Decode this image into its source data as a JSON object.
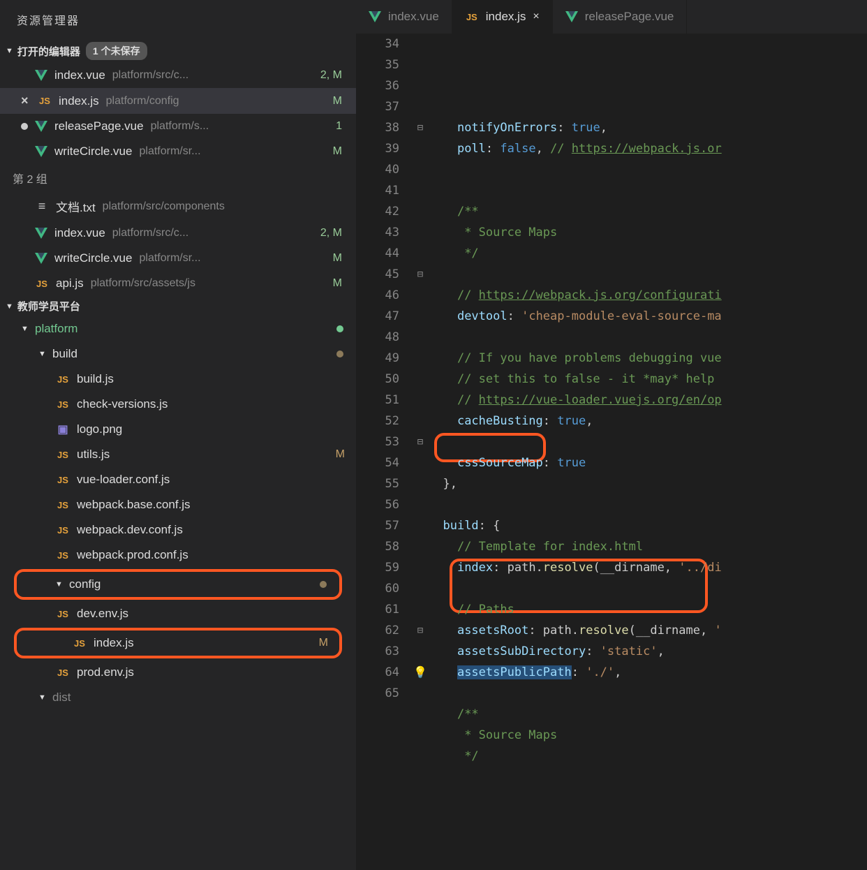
{
  "sidebar": {
    "title": "资源管理器",
    "openEditors": {
      "label": "打开的编辑器",
      "unsavedBadge": "1 个未保存",
      "groups": [
        {
          "items": [
            {
              "dot": false,
              "close": false,
              "icon": "vue",
              "name": "index.vue",
              "path": "platform/src/c...",
              "status": "2, M"
            },
            {
              "dot": false,
              "close": true,
              "icon": "js",
              "name": "index.js",
              "path": "platform/config",
              "status": "M",
              "active": true
            },
            {
              "dot": true,
              "close": false,
              "icon": "vue",
              "name": "releasePage.vue",
              "path": "platform/s...",
              "status": "1"
            },
            {
              "dot": false,
              "close": false,
              "icon": "vue",
              "name": "writeCircle.vue",
              "path": "platform/sr...",
              "status": "M"
            }
          ]
        },
        {
          "label": "第 2 组",
          "items": [
            {
              "dot": false,
              "close": false,
              "icon": "txt",
              "name": "文档.txt",
              "path": "platform/src/components",
              "status": ""
            },
            {
              "dot": false,
              "close": false,
              "icon": "vue",
              "name": "index.vue",
              "path": "platform/src/c...",
              "status": "2, M"
            },
            {
              "dot": false,
              "close": false,
              "icon": "vue",
              "name": "writeCircle.vue",
              "path": "platform/sr...",
              "status": "M"
            },
            {
              "dot": false,
              "close": false,
              "icon": "js",
              "name": "api.js",
              "path": "platform/src/assets/js",
              "status": "M"
            }
          ]
        }
      ]
    },
    "workspace": {
      "label": "教师学员平台",
      "tree": [
        {
          "level": 0,
          "type": "folder",
          "open": true,
          "name": "platform",
          "nameClass": "green",
          "dot": "green"
        },
        {
          "level": 1,
          "type": "folder",
          "open": true,
          "name": "build",
          "dot": "brown"
        },
        {
          "level": 2,
          "type": "file",
          "icon": "js",
          "name": "build.js",
          "status": ""
        },
        {
          "level": 2,
          "type": "file",
          "icon": "js",
          "name": "check-versions.js",
          "status": ""
        },
        {
          "level": 2,
          "type": "file",
          "icon": "img",
          "name": "logo.png",
          "status": ""
        },
        {
          "level": 2,
          "type": "file",
          "icon": "js",
          "name": "utils.js",
          "status": "M"
        },
        {
          "level": 2,
          "type": "file",
          "icon": "js",
          "name": "vue-loader.conf.js",
          "status": ""
        },
        {
          "level": 2,
          "type": "file",
          "icon": "js",
          "name": "webpack.base.conf.js",
          "status": ""
        },
        {
          "level": 2,
          "type": "file",
          "icon": "js",
          "name": "webpack.dev.conf.js",
          "status": ""
        },
        {
          "level": 2,
          "type": "file",
          "icon": "js",
          "name": "webpack.prod.conf.js",
          "status": ""
        },
        {
          "level": 1,
          "type": "folder",
          "open": true,
          "name": "config",
          "dot": "brown",
          "highlight": true
        },
        {
          "level": 2,
          "type": "file",
          "icon": "js",
          "name": "dev.env.js",
          "status": ""
        },
        {
          "level": 2,
          "type": "file",
          "icon": "js",
          "name": "index.js",
          "status": "M",
          "highlight": true
        },
        {
          "level": 2,
          "type": "file",
          "icon": "js",
          "name": "prod.env.js",
          "status": ""
        },
        {
          "level": 1,
          "type": "folder",
          "open": true,
          "name": "dist",
          "nameClass": "dim"
        }
      ]
    }
  },
  "tabs": [
    {
      "icon": "vue",
      "name": "index.vue",
      "active": false,
      "close": false
    },
    {
      "icon": "js",
      "name": "index.js",
      "active": true,
      "close": true
    },
    {
      "icon": "vue",
      "name": "releasePage.vue",
      "active": false,
      "close": false
    }
  ],
  "code": {
    "startLine": 34,
    "lines": [
      {
        "n": 34,
        "html": "    <span class='tok-prop'>notifyOnErrors</span>: <span class='tok-bool'>true</span>,"
      },
      {
        "n": 35,
        "html": "    <span class='tok-prop'>poll</span>: <span class='tok-bool'>false</span>, <span class='tok-comment'>// </span><span class='tok-link'>https://webpack.js.or</span>"
      },
      {
        "n": 36,
        "html": ""
      },
      {
        "n": 37,
        "html": ""
      },
      {
        "n": 38,
        "fold": "⊟",
        "html": "    <span class='tok-comment'>/**</span>"
      },
      {
        "n": 39,
        "html": "    <span class='tok-comment'> * Source Maps</span>"
      },
      {
        "n": 40,
        "html": "    <span class='tok-comment'> */</span>"
      },
      {
        "n": 41,
        "html": ""
      },
      {
        "n": 42,
        "html": "    <span class='tok-comment'>// </span><span class='tok-link'>https://webpack.js.org/configurati</span>"
      },
      {
        "n": 43,
        "html": "    <span class='tok-prop'>devtool</span>: <span class='tok-string'>'cheap-module-eval-source-ma</span>"
      },
      {
        "n": 44,
        "html": ""
      },
      {
        "n": 45,
        "fold": "⊟",
        "html": "    <span class='tok-comment'>// If you have problems debugging vue</span>"
      },
      {
        "n": 46,
        "html": "    <span class='tok-comment'>// set this to false - it *may* help</span>"
      },
      {
        "n": 47,
        "html": "    <span class='tok-comment'>// </span><span class='tok-link'>https://vue-loader.vuejs.org/en/op</span>"
      },
      {
        "n": 48,
        "html": "    <span class='tok-prop'>cacheBusting</span>: <span class='tok-bool'>true</span>,"
      },
      {
        "n": 49,
        "html": ""
      },
      {
        "n": 50,
        "html": "    <span class='tok-prop'>cssSourceMap</span>: <span class='tok-bool'>true</span>"
      },
      {
        "n": 51,
        "html": "  <span class='tok-punc'>},</span>"
      },
      {
        "n": 52,
        "html": ""
      },
      {
        "n": 53,
        "fold": "⊟",
        "html": "  <span class='tok-prop'>build</span>: <span class='tok-punc'>{</span>"
      },
      {
        "n": 54,
        "html": "    <span class='tok-comment'>// Template for index.html</span>"
      },
      {
        "n": 55,
        "html": "    <span class='tok-prop'>index</span>: path.<span class='tok-func'>resolve</span>(__dirname, <span class='tok-string'>'../di</span>"
      },
      {
        "n": 56,
        "html": ""
      },
      {
        "n": 57,
        "html": "    <span class='tok-comment'>// Paths</span>"
      },
      {
        "n": 58,
        "html": "    <span class='tok-prop'>assetsRoot</span>: path.<span class='tok-func'>resolve</span>(__dirname, <span class='tok-string'>'</span>"
      },
      {
        "n": 59,
        "html": "    <span class='tok-prop'>assetsSubDirectory</span>: <span class='tok-string'>'static'</span>,"
      },
      {
        "n": 60,
        "bulb": true,
        "html": "    <span class='tok-sel'><span class='tok-prop'>assetsPublicPath</span></span>: <span class='tok-string'>'./'</span>,"
      },
      {
        "n": 61,
        "html": ""
      },
      {
        "n": 62,
        "fold": "⊟",
        "html": "    <span class='tok-comment'>/**</span>"
      },
      {
        "n": 63,
        "html": "    <span class='tok-comment'> * Source Maps</span>"
      },
      {
        "n": 64,
        "html": "    <span class='tok-comment'> */</span>"
      },
      {
        "n": 65,
        "html": ""
      }
    ]
  }
}
